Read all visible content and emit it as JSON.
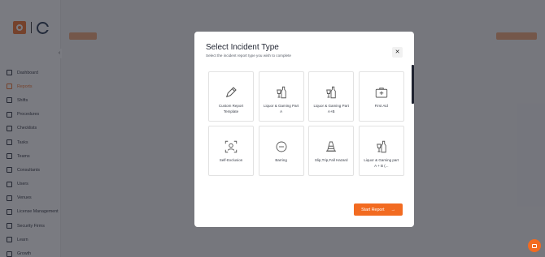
{
  "sidebar": {
    "items": [
      {
        "label": "Dashboard",
        "icon": "dashboard-icon",
        "active": false
      },
      {
        "label": "Reports",
        "icon": "reports-icon",
        "active": true
      },
      {
        "label": "Shifts",
        "icon": "shifts-icon",
        "active": false
      },
      {
        "label": "Procedures",
        "icon": "procedures-icon",
        "active": false
      },
      {
        "label": "Checklists",
        "icon": "checklists-icon",
        "active": false
      },
      {
        "label": "Tasks",
        "icon": "tasks-icon",
        "active": false
      },
      {
        "label": "Teams",
        "icon": "teams-icon",
        "active": false
      },
      {
        "label": "Consultants",
        "icon": "consultants-icon",
        "active": false
      },
      {
        "label": "Users",
        "icon": "users-icon",
        "active": false
      },
      {
        "label": "Venues",
        "icon": "venues-icon",
        "active": false
      },
      {
        "label": "License Management",
        "icon": "license-icon",
        "active": false
      },
      {
        "label": "Security Firms",
        "icon": "security-icon",
        "active": false
      },
      {
        "label": "Learn",
        "icon": "learn-icon",
        "active": false
      },
      {
        "label": "Growth",
        "icon": "growth-icon",
        "active": false
      }
    ]
  },
  "modal": {
    "title": "Select Incident Type",
    "subtitle": "Select the incident report type you wish to complete",
    "close_label": "✕",
    "start_label": "Start Report",
    "cards": [
      {
        "label": "Custom Report Template",
        "icon": "pen-icon"
      },
      {
        "label": "Liquor & Gaming Part A",
        "icon": "bottle-glass-icon"
      },
      {
        "label": "Liquor & Gaming Part A+B",
        "icon": "bottle-glass-icon"
      },
      {
        "label": "First Aid",
        "icon": "first-aid-icon"
      },
      {
        "label": "Self-Exclusion",
        "icon": "user-frame-icon"
      },
      {
        "label": "Barring",
        "icon": "no-entry-icon"
      },
      {
        "label": "Slip,Trip,Fall Hazard",
        "icon": "cone-icon"
      },
      {
        "label": "Liquor & Gaming part A + B (...",
        "icon": "bottle-glass-icon"
      }
    ]
  },
  "colors": {
    "accent": "#f26b21",
    "dark": "#1f2330"
  }
}
